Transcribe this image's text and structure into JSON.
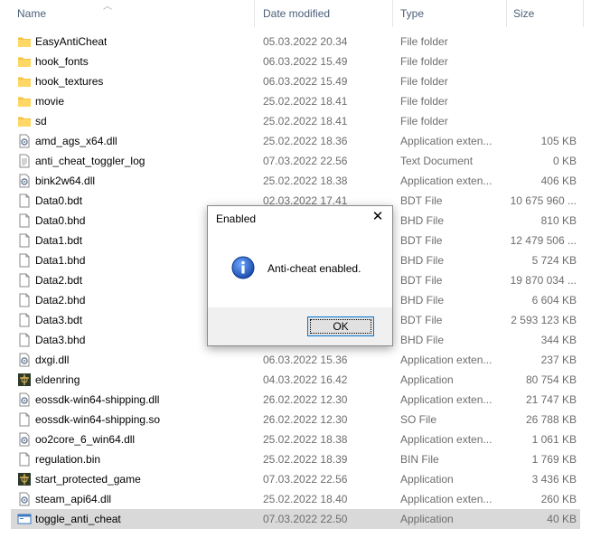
{
  "columns": {
    "name": "Name",
    "date": "Date modified",
    "type": "Type",
    "size": "Size"
  },
  "files": [
    {
      "name": "EasyAntiCheat",
      "date": "05.03.2022 20.34",
      "type": "File folder",
      "size": "",
      "icon": "folder-icon"
    },
    {
      "name": "hook_fonts",
      "date": "06.03.2022 15.49",
      "type": "File folder",
      "size": "",
      "icon": "folder-icon"
    },
    {
      "name": "hook_textures",
      "date": "06.03.2022 15.49",
      "type": "File folder",
      "size": "",
      "icon": "folder-icon"
    },
    {
      "name": "movie",
      "date": "25.02.2022 18.41",
      "type": "File folder",
      "size": "",
      "icon": "folder-icon"
    },
    {
      "name": "sd",
      "date": "25.02.2022 18.41",
      "type": "File folder",
      "size": "",
      "icon": "folder-icon"
    },
    {
      "name": "amd_ags_x64.dll",
      "date": "25.02.2022 18.36",
      "type": "Application exten...",
      "size": "105 KB",
      "icon": "dll-icon"
    },
    {
      "name": "anti_cheat_toggler_log",
      "date": "07.03.2022 22.56",
      "type": "Text Document",
      "size": "0 KB",
      "icon": "text-file-icon"
    },
    {
      "name": "bink2w64.dll",
      "date": "25.02.2022 18.38",
      "type": "Application exten...",
      "size": "406 KB",
      "icon": "dll-icon"
    },
    {
      "name": "Data0.bdt",
      "date": "02.03.2022 17.41",
      "type": "BDT File",
      "size": "10 675 960 ...",
      "icon": "file-icon"
    },
    {
      "name": "Data0.bhd",
      "date": "",
      "type": "BHD File",
      "size": "810 KB",
      "icon": "file-icon"
    },
    {
      "name": "Data1.bdt",
      "date": "",
      "type": "BDT File",
      "size": "12 479 506 ...",
      "icon": "file-icon"
    },
    {
      "name": "Data1.bhd",
      "date": "",
      "type": "BHD File",
      "size": "5 724 KB",
      "icon": "file-icon"
    },
    {
      "name": "Data2.bdt",
      "date": "",
      "type": "BDT File",
      "size": "19 870 034 ...",
      "icon": "file-icon"
    },
    {
      "name": "Data2.bhd",
      "date": "",
      "type": "BHD File",
      "size": "6 604 KB",
      "icon": "file-icon"
    },
    {
      "name": "Data3.bdt",
      "date": "",
      "type": "BDT File",
      "size": "2 593 123 KB",
      "icon": "file-icon"
    },
    {
      "name": "Data3.bhd",
      "date": "",
      "type": "BHD File",
      "size": "344 KB",
      "icon": "file-icon"
    },
    {
      "name": "dxgi.dll",
      "date": "06.03.2022 15.36",
      "type": "Application exten...",
      "size": "237 KB",
      "icon": "dll-icon"
    },
    {
      "name": "eldenring",
      "date": "04.03.2022 16.42",
      "type": "Application",
      "size": "80 754 KB",
      "icon": "game-app-icon"
    },
    {
      "name": "eossdk-win64-shipping.dll",
      "date": "26.02.2022 12.30",
      "type": "Application exten...",
      "size": "21 747 KB",
      "icon": "dll-icon"
    },
    {
      "name": "eossdk-win64-shipping.so",
      "date": "26.02.2022 12.30",
      "type": "SO File",
      "size": "26 788 KB",
      "icon": "file-icon"
    },
    {
      "name": "oo2core_6_win64.dll",
      "date": "25.02.2022 18.38",
      "type": "Application exten...",
      "size": "1 061 KB",
      "icon": "dll-icon"
    },
    {
      "name": "regulation.bin",
      "date": "25.02.2022 18.39",
      "type": "BIN File",
      "size": "1 769 KB",
      "icon": "file-icon"
    },
    {
      "name": "start_protected_game",
      "date": "07.03.2022 22.56",
      "type": "Application",
      "size": "3 436 KB",
      "icon": "game-app-icon"
    },
    {
      "name": "steam_api64.dll",
      "date": "25.02.2022 18.40",
      "type": "Application exten...",
      "size": "260 KB",
      "icon": "dll-icon"
    },
    {
      "name": "toggle_anti_cheat",
      "date": "07.03.2022 22.50",
      "type": "Application",
      "size": "40 KB",
      "icon": "window-app-icon",
      "selected": true
    }
  ],
  "dialog": {
    "title": "Enabled",
    "close": "✕",
    "message": "Anti-cheat enabled.",
    "ok_label": "OK",
    "icon": "info-icon"
  },
  "colors": {
    "selection": "#d9d9d9",
    "folder": "#f5c342",
    "info_blue": "#1f5fbf",
    "button_border": "#0078d7"
  }
}
